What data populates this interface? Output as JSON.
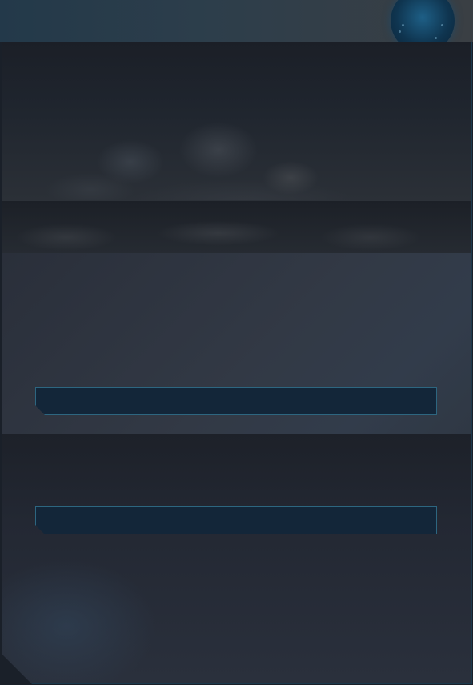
{
  "header": {
    "orb_icon": "globe-orb-icon"
  },
  "banner": {
    "image": "rocky-cave-banner"
  },
  "form": {
    "field_1": {
      "value": "",
      "placeholder": ""
    },
    "field_2": {
      "value": "",
      "placeholder": ""
    }
  },
  "colors": {
    "panel_bg": "#1b2029",
    "field_bg": "#132639",
    "field_border": "#2d6680",
    "accent": "#1e5f86"
  }
}
